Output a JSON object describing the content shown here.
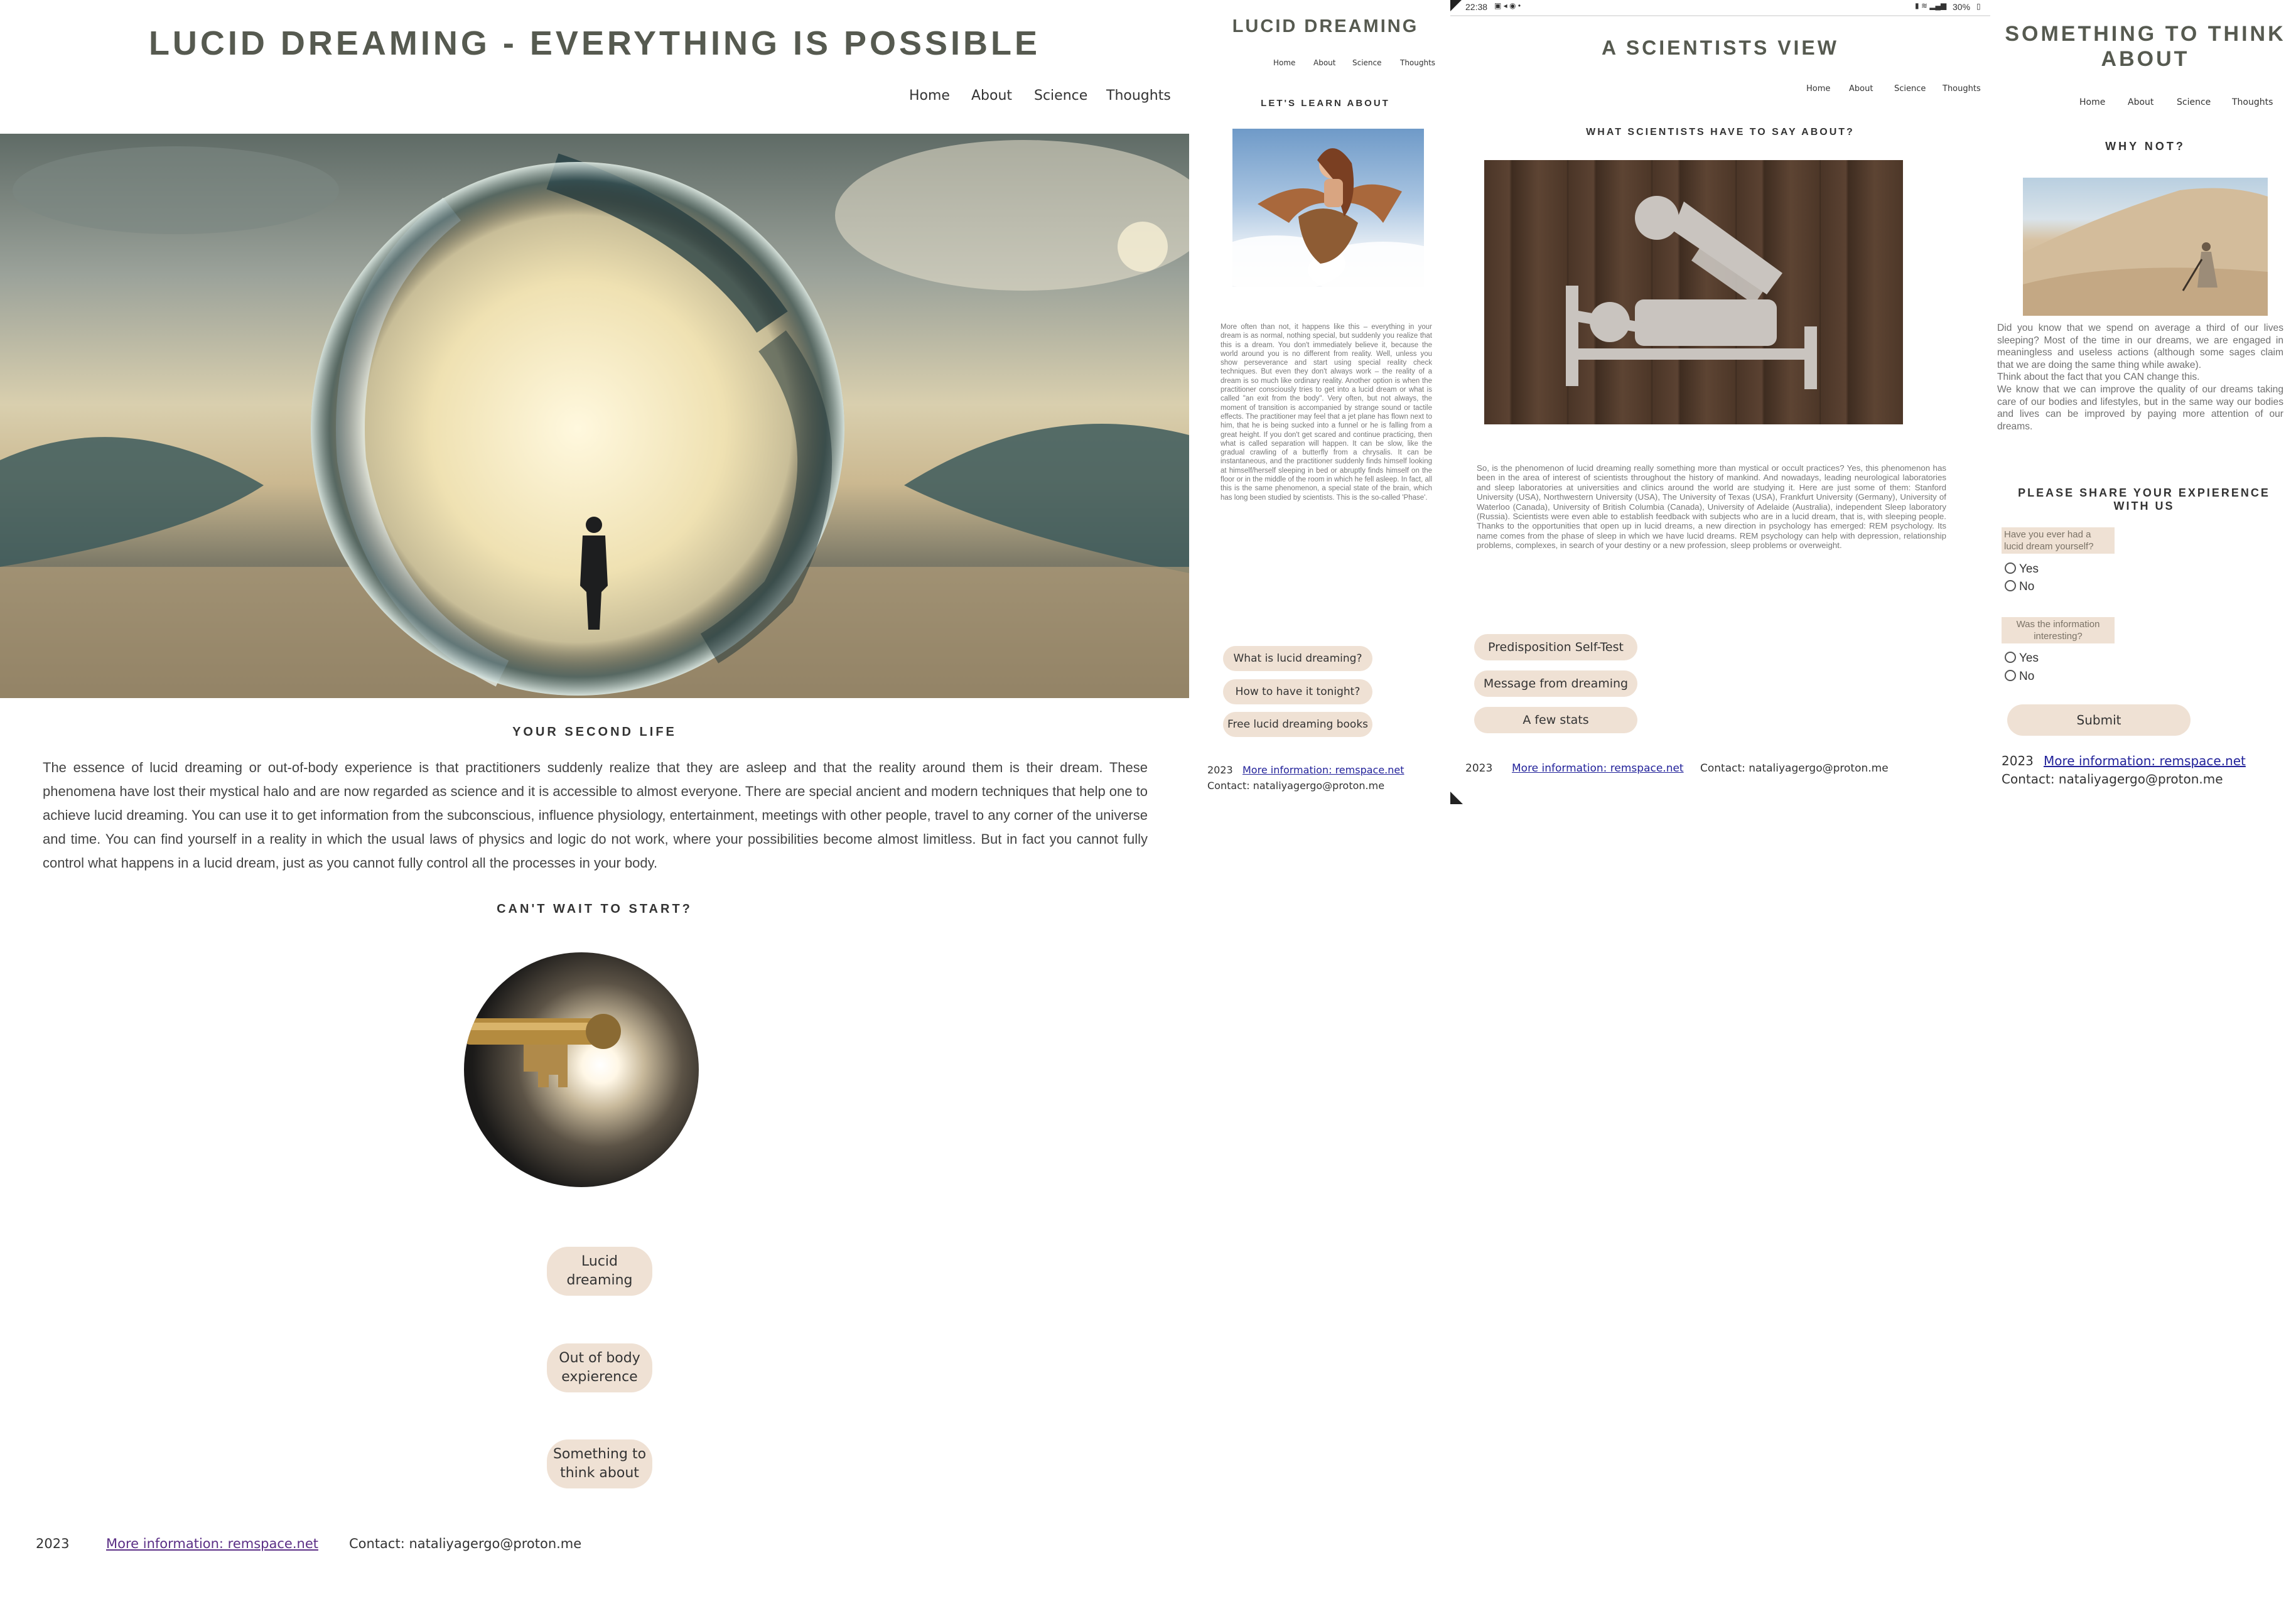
{
  "page1": {
    "title": "LUCID DREAMING - EVERYTHING IS POSSIBLE",
    "nav": [
      "Home",
      "About",
      "Science",
      "Thoughts"
    ],
    "section_heading": "YOUR SECOND LIFE",
    "body_text": "The essence of lucid dreaming or out-of-body experience is that practitioners suddenly realize that they are asleep and that the reality around them is their dream. These phenomena have lost their mystical halo and are now regarded as science and it is accessible to almost everyone. There are special ancient and modern techniques that help one to achieve lucid dreaming. You can use it to get information from the subconscious, influence physiology, entertainment, meetings with other people, travel to any corner of the universe and time. You can find yourself in a reality in which the usual laws of physics and logic do not work, where your possibilities become almost limitless. But in fact you cannot fully control what happens in a lucid dream, just as you cannot fully control all the processes in your body.",
    "cta_heading": "CAN'T WAIT TO START?",
    "buttons": [
      "Lucid dreaming",
      "Out of body expierence",
      "Something to think about"
    ],
    "footer": {
      "year": "2023",
      "link": "More information: remspace.net",
      "contact": "Contact: nataliyagergo@proton.me"
    }
  },
  "page2": {
    "title": "LUCID DREAMING",
    "nav": [
      "Home",
      "About",
      "Science",
      "Thoughts"
    ],
    "section_heading": "LET'S LEARN ABOUT",
    "body_text": "More often than not, it happens like this – everything in your dream is as normal, nothing special, but suddenly you realize that this is a dream. You don't immediately believe it, because the world around you is no different from reality. Well, unless you show perseverance and start using special reality check techniques. But even they don't always work – the reality of a dream is so much like ordinary reality. Another option is when the practitioner consciously tries to get into a lucid dream or what is called \"an exit from the body\". Very often, but not always, the moment of transition is accompanied by strange sound or tactile effects. The practitioner may feel that a jet plane has flown next to him, that he is being sucked into a funnel or he is falling from a great height. If you don't get scared and continue practicing, then what is called separation will happen. It can be slow, like the gradual crawling of a butterfly from a chrysalis. It can be instantaneous, and the practitioner suddenly finds himself looking at himself/herself sleeping in bed or abruptly finds himself on the floor or in the middle of the room in which he fell asleep. In fact, all this is the same phenomenon, a special state of the brain, which has long been studied by scientists. This is the so-called 'Phase'.",
    "buttons": [
      "What is lucid dreaming?",
      "How to have it tonight?",
      "Free lucid dreaming books"
    ],
    "footer": {
      "year": "2023",
      "link": "More information: remspace.net",
      "contact": "Contact: nataliyagergo@proton.me"
    }
  },
  "page3": {
    "status_time": "22:38",
    "status_battery": "30%",
    "title": "A SCIENTISTS VIEW",
    "nav": [
      "Home",
      "About",
      "Science",
      "Thoughts"
    ],
    "section_heading": "WHAT SCIENTISTS HAVE TO SAY ABOUT?",
    "body_text": "So, is the phenomenon of lucid dreaming really something more than mystical or occult practices? Yes, this phenomenon has been in the area of interest of scientists throughout the history of mankind. And nowadays, leading neurological laboratories and sleep laboratories at universities and clinics around the world are studying it. Here are just some of them: Stanford University (USA), Northwestern University (USA), The University of Texas (USA), Frankfurt University (Germany), University of Waterloo (Canada), University of British Columbia (Canada), University of Adelaide (Australia), independent Sleep laboratory (Russia). Scientists were even able to establish feedback with subjects who are in a lucid dream, that is, with sleeping people. Thanks to the opportunities that open up in lucid dreams, a new direction in psychology has emerged: REM psychology. Its name comes from the phase of sleep in which we have lucid dreams. REM psychology can help with depression, relationship problems, complexes, in search of your destiny or a new profession, sleep problems or overweight.",
    "buttons": [
      "Predisposition Self-Test",
      "Message from dreaming",
      "A few stats"
    ],
    "footer": {
      "year": "2023",
      "link": "More information: remspace.net",
      "contact": "Contact: nataliyagergo@proton.me"
    }
  },
  "page4": {
    "title": "SOMETHING TO THINK ABOUT",
    "nav": [
      "Home",
      "About",
      "Science",
      "Thoughts"
    ],
    "section_heading": "WHY NOT?",
    "body_text_1": "Did you know that we spend on average a third of our lives sleeping? Most of the time in our dreams, we are engaged in meaningless and useless actions (although some sages claim that we are doing the same thing while awake).",
    "body_text_2": "Think about the fact that you CAN change this.",
    "body_text_3": "We know that we can improve the quality of our dreams taking care of our bodies and lifestyles, but in the same way our bodies and lives can be improved by paying more attention of our dreams.",
    "form_heading": "PLEASE SHARE YOUR EXPIERENCE WITH US",
    "q1": "Have you ever had a lucid dream yourself?",
    "q2": "Was the information interesting?",
    "yes": "Yes",
    "no": "No",
    "submit": "Submit",
    "footer": {
      "year": "2023",
      "link": "More information: remspace.net",
      "contact": "Contact: nataliyagergo@proton.me"
    }
  },
  "colors": {
    "button_bg": "#efe1d4",
    "title": "#565a50",
    "link": "#3b2a8c"
  }
}
